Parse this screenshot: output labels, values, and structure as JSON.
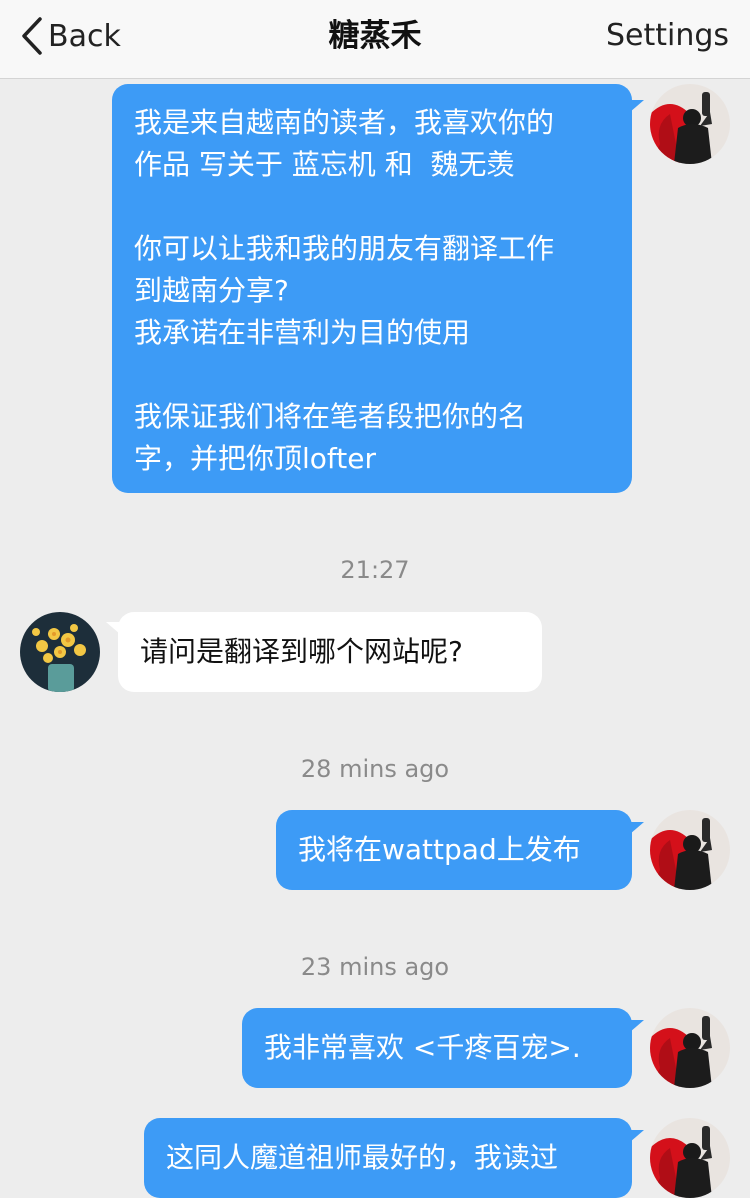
{
  "navbar": {
    "back_label": "Back",
    "title": "糖蒸禾",
    "settings_label": "Settings"
  },
  "messages": [
    {
      "direction": "outgoing",
      "paragraphs": [
        "我是来自越南的读者，我喜欢你的\n作品 写关于 蓝忘机 和  魏无羡",
        "你可以让我和我的朋友有翻译工作\n到越南分享?\n我承诺在非营利为目的使用",
        "我保证我们将在笔者段把你的名\n字，并把你顶lofter"
      ]
    },
    {
      "timestamp": "21:27"
    },
    {
      "direction": "incoming",
      "text": "请问是翻译到哪个网站呢?"
    },
    {
      "timestamp": "28 mins ago"
    },
    {
      "direction": "outgoing",
      "text": "我将在wattpad上发布"
    },
    {
      "timestamp": "23 mins ago"
    },
    {
      "direction": "outgoing",
      "text": "我非常喜欢 <千疼百宠>."
    },
    {
      "direction": "outgoing",
      "text": "这同人魔道祖师最好的，我读过"
    }
  ],
  "colors": {
    "outgoing_bubble": "#3d9bf6",
    "incoming_bubble": "#ffffff",
    "background": "#ededed",
    "timestamp_text": "#8a8a8a"
  },
  "icons": {
    "back": "chevron-left-icon",
    "self_avatar": "self-avatar (person with red cape)",
    "contact_avatar": "contact-avatar (yellow flowers in vase)"
  }
}
